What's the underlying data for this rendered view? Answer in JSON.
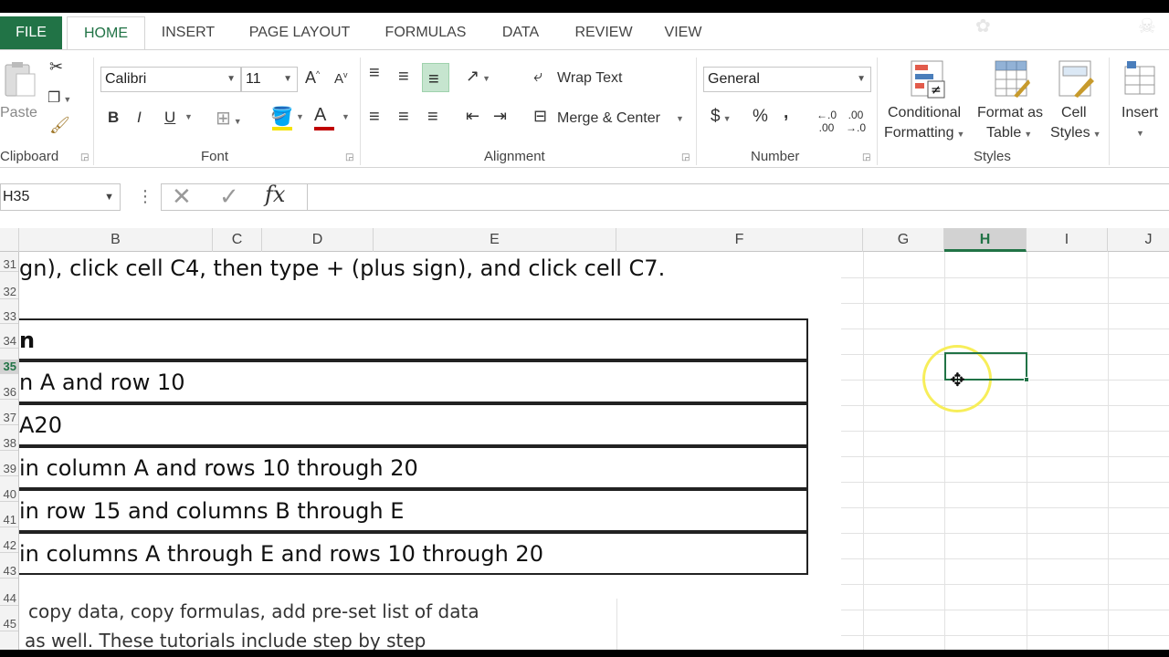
{
  "tabs": [
    "FILE",
    "HOME",
    "INSERT",
    "PAGE LAYOUT",
    "FORMULAS",
    "DATA",
    "REVIEW",
    "VIEW"
  ],
  "ribbon": {
    "clipboard": {
      "paste_label": "Paste",
      "group_label": "Clipboard"
    },
    "font": {
      "font_name": "Calibri",
      "font_size": "11",
      "group_label": "Font",
      "bold": "B",
      "italic": "I",
      "underline": "U"
    },
    "alignment": {
      "wrap_text": "Wrap Text",
      "merge_center": "Merge & Center",
      "group_label": "Alignment"
    },
    "number": {
      "format": "General",
      "group_label": "Number",
      "currency": "$",
      "percent": "%",
      "comma": ","
    },
    "styles": {
      "conditional_line1": "Conditional",
      "conditional_line2": "Formatting",
      "format_table_line1": "Format as",
      "format_table_line2": "Table",
      "cell_styles_line1": "Cell",
      "cell_styles_line2": "Styles",
      "group_label": "Styles"
    },
    "cells": {
      "insert_label": "Insert"
    }
  },
  "formula_bar": {
    "name_box": "H35",
    "fx": "fx",
    "value": ""
  },
  "columns": [
    {
      "label": "B"
    },
    {
      "label": "C"
    },
    {
      "label": "D"
    },
    {
      "label": "E"
    },
    {
      "label": "F"
    },
    {
      "label": "G"
    },
    {
      "label": "H"
    },
    {
      "label": "I"
    },
    {
      "label": "J"
    }
  ],
  "rows": [
    "31",
    "32",
    "33",
    "34",
    "35",
    "36",
    "37",
    "38",
    "39",
    "40",
    "41",
    "42",
    "43",
    "44",
    "45"
  ],
  "content": {
    "line31": "gn), click cell C4, then type + (plus sign), and click cell C7.",
    "table": [
      "n",
      "n A and row 10",
      "A20",
      " in column A and rows 10 through 20",
      " in row 15 and columns B through E",
      " in columns A through E and rows 10 through 20"
    ],
    "line44": "copy data, copy formulas, add pre-set list of data",
    "line45": "as well. These tutorials include step by step"
  },
  "colors": {
    "accent": "#217346",
    "spotlight": "#f7ee5a"
  }
}
